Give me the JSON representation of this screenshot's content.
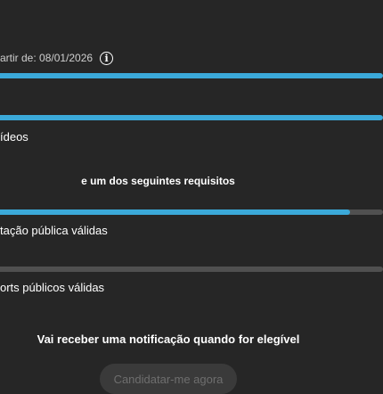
{
  "eligibility": {
    "date_text": "artir de: 08/01/2026",
    "info_icon": "info-icon"
  },
  "requirements": [
    {
      "label": "",
      "progress": 1.0
    },
    {
      "label": "ídeos",
      "progress": 1.0
    }
  ],
  "secondary_heading": "e um dos seguintes requisitos",
  "secondary_requirements": [
    {
      "label": "tação pública válidas",
      "progress": 0.915
    },
    {
      "label": "orts públicos válidas",
      "progress": 0.0
    }
  ],
  "notification_text": "Vai receber uma notificação quando for elegível",
  "apply_button_label": "Candidatar-me agora",
  "colors": {
    "background": "#262626",
    "accent": "#3ba9d9",
    "track": "#505050",
    "button_bg": "#3a3a3a",
    "button_text": "#6e6e6e"
  }
}
